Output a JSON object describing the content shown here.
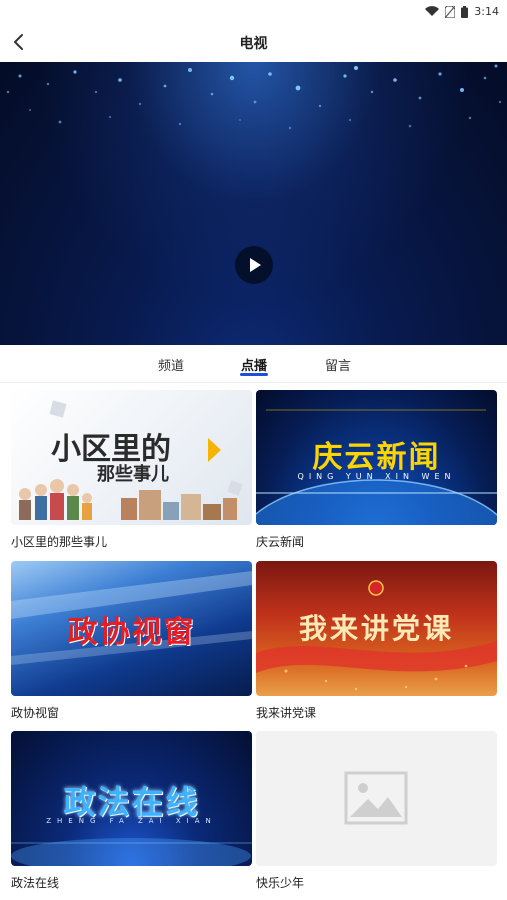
{
  "status_bar": {
    "time": "3:14"
  },
  "header": {
    "title": "电视"
  },
  "tabs": [
    {
      "label": "频道"
    },
    {
      "label": "点播",
      "active": true
    },
    {
      "label": "留言"
    }
  ],
  "programs": [
    {
      "label": "小区里的那些事儿",
      "thumb_title_line1": "小区里的",
      "thumb_title_line2": "那些事儿"
    },
    {
      "label": "庆云新闻",
      "thumb_title": "庆云新闻",
      "thumb_subtitle": "QING YUN XIN WEN"
    },
    {
      "label": "政协视窗",
      "thumb_title": "政协视窗"
    },
    {
      "label": "我来讲党课",
      "thumb_title": "我来讲党课"
    },
    {
      "label": "政法在线",
      "thumb_title": "政法在线",
      "thumb_subtitle": "ZHENG FA ZAI XIAN"
    },
    {
      "label": "快乐少年"
    }
  ],
  "colors": {
    "accent": "#1d4fd8",
    "video_bg": "#081a4e"
  }
}
